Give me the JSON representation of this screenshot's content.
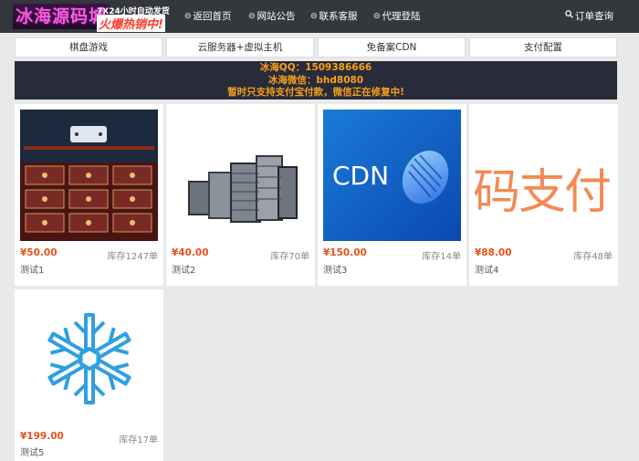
{
  "header": {
    "logo_text": "冰海源码城",
    "logo_slogan": "7X24小时自动发货",
    "logo_hot": "火爆热销中!",
    "nav": [
      {
        "label": "返回首页",
        "icon": "link-icon"
      },
      {
        "label": "网站公告",
        "icon": "link-icon"
      },
      {
        "label": "联系客服",
        "icon": "link-icon"
      },
      {
        "label": "代理登陆",
        "icon": "link-icon"
      }
    ],
    "order_query": {
      "label": "订单查询",
      "icon": "search-icon"
    }
  },
  "tabs": [
    "棋盘游戏",
    "云服务器+虚拟主机",
    "免备案CDN",
    "支付配置"
  ],
  "notice": {
    "line1": "冰海QQ：1509386666",
    "line2": "冰海微信：bhd8080",
    "line3": "暂时只支持支付宝付款，微信正在修复中!"
  },
  "products": [
    {
      "price": "¥50.00",
      "stock": "库存1247单",
      "name": "测试1",
      "image": "game-lobby-image"
    },
    {
      "price": "¥40.00",
      "stock": "库存70单",
      "name": "测试2",
      "image": "servers-image"
    },
    {
      "price": "¥150.00",
      "stock": "库存14单",
      "name": "测试3",
      "image": "cdn-image",
      "image_text": "CDN"
    },
    {
      "price": "¥88.00",
      "stock": "库存48单",
      "name": "测试4",
      "image": "code-pay-image",
      "image_text": "码支付"
    },
    {
      "price": "¥199.00",
      "stock": "库存17单",
      "name": "测试5",
      "image": "snowflake-image"
    }
  ],
  "colors": {
    "topbar": "#34373c",
    "notice_bg": "#272b3a",
    "notice_text": "#f7a11a",
    "price": "#e8501c"
  }
}
